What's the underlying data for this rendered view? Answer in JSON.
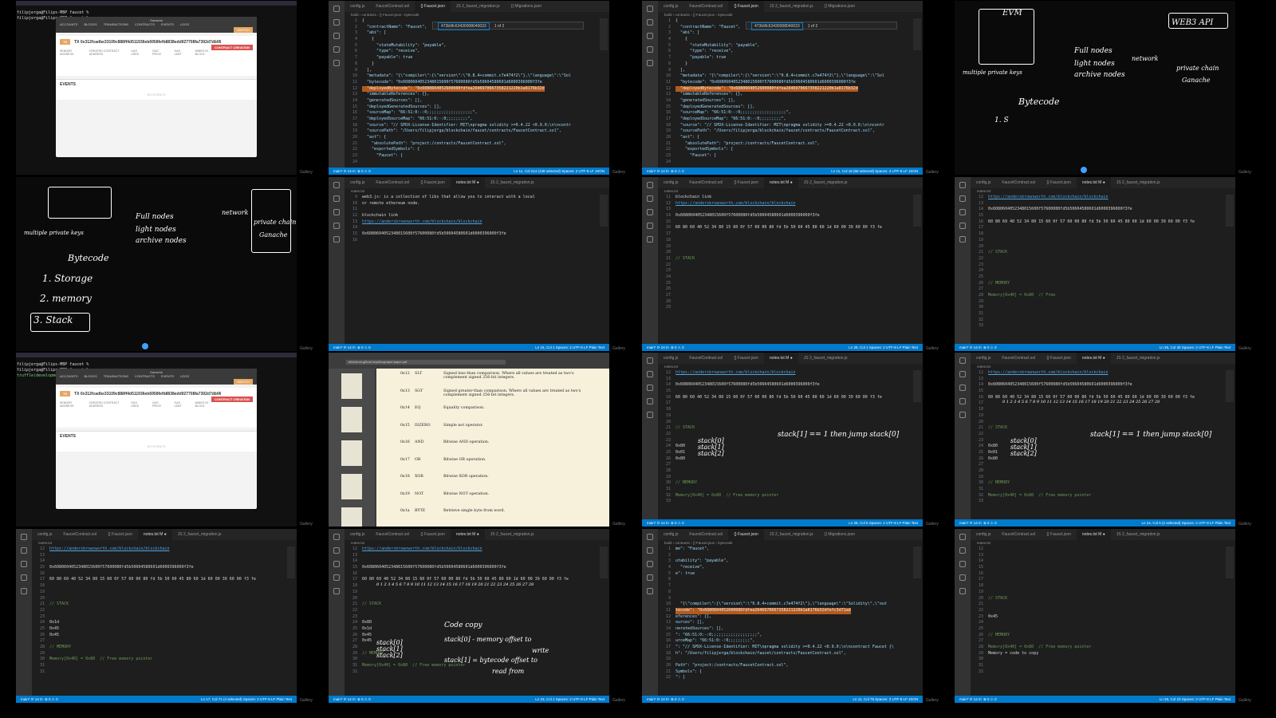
{
  "side_label": "Gallery",
  "editor_tabs_a": [
    "config.js",
    "FaucetContract.sol",
    "{} Faucet.json",
    "JS 2_faucet_migration.js",
    "{} Migrations.json"
  ],
  "editor_tabs_b": [
    "config.js",
    "FaucetContract.sol",
    "{} Faucet.json",
    "notes.txt M ●",
    "JS 2_faucet_migration.js"
  ],
  "branch": "main*  ⟳ 14 0↑  ⊗ 0 ⚠ 0",
  "find": {
    "query": "473b9fc63430008040033",
    "count": "1 of 2"
  },
  "json_crumb": "build › contracts › {} Faucet.json › bytecode",
  "notes_crumb": "notes.txt",
  "json_lines": [
    [
      "{",
      "w"
    ],
    [
      "  \"contractName\": \"Faucet\",",
      "k"
    ],
    [
      "  \"abi\": [",
      "k"
    ],
    [
      "    {",
      "w"
    ],
    [
      "      \"stateMutability\": \"payable\",",
      "k"
    ],
    [
      "      \"type\": \"receive\",",
      "k"
    ],
    [
      "      \"payable\": true",
      "k"
    ],
    [
      "    }",
      "w"
    ],
    [
      "  ],",
      "w"
    ],
    [
      "  \"metadata\": \"{\\\"compiler\\\":{\\\"version\\\":\\\"0.8.4+commit.c7e474f2\\\"},\\\"language\\\":\\\"Sol",
      "k"
    ],
    [
      "  \"bytecode\": \"0x6080604052348015600f57600080fd5b50604580601d6000396000f3fe",
      "k"
    ],
    [
      "  \"deployedBytecode\": \"0x6080604052600080fdfea2646970667358221220b1a8176b32d",
      "sel"
    ],
    [
      "  \"immutableReferences\": {},",
      "k"
    ],
    [
      "  \"generatedSources\": [],",
      "k"
    ],
    [
      "  \"deployedGeneratedSources\": [],",
      "k"
    ],
    [
      "  \"sourceMap\": \"66:51:0:-:0;;;;;;;;;;;;;;;;;;;\",",
      "k"
    ],
    [
      "  \"deployedSourceMap\": \"66:51:0:-:0;;;;;;;;;\",",
      "k"
    ],
    [
      "  \"source\": \"// SPDX-License-Identifier: MIT\\npragma solidity >=0.4.22 <0.9.0;\\n\\ncontr",
      "k"
    ],
    [
      "  \"sourcePath\": \"/Users/filipjerga/blockchain/faucet/contracts/FaucetContract.sol\",",
      "k"
    ],
    [
      "  \"ast\": {",
      "k"
    ],
    [
      "    \"absolutePath\": \"project:/contracts/FaucetContract.sol\",",
      "k"
    ],
    [
      "    \"exportedSymbols\": {",
      "k"
    ],
    [
      "      \"Faucet\": [",
      "k"
    ],
    [
      "        ",
      "w"
    ]
  ],
  "json_lines_scrolled": [
    [
      "me\": \"Faucet\",",
      "k"
    ],
    [
      "",
      "w"
    ],
    [
      "utability\": \"payable\",",
      "k"
    ],
    [
      "  \"receive\",",
      "k"
    ],
    [
      "e\": true",
      "k"
    ],
    [
      "",
      "w"
    ],
    [
      "",
      "w"
    ],
    [
      "",
      "w"
    ],
    [
      "",
      "w"
    ],
    [
      "  \"{\\\"compiler\\\":{\\\"version\\\":\\\"0.8.4+commit.c7e474f2\\\"},\\\"language\\\":\\\"Solidity\\\",\\\"out",
      "k"
    ],
    [
      "tecode\": \"0x6080604052600080fdfea2646970667358221220b1a8176b32dfefc3d71ad",
      "sel"
    ],
    [
      "eferences\": {},",
      "k"
    ],
    [
      "ources\": [],",
      "k"
    ],
    [
      "neratedSources\": [],",
      "k"
    ],
    [
      "\": \"66:51:0:-:0;;;;;;;;;;;;;;;;;;;\",",
      "k"
    ],
    [
      "urceMap\": \"66:51:0:-:0;;;;;;;;;\",",
      "k"
    ],
    [
      "\": \"// SPDX-License-Identifier: MIT\\npragma solidity >=0.4.22 <0.9.0;\\n\\ncontract Faucet {\\",
      "k"
    ],
    [
      "h\": \"/Users/filipjerga/blockchain/faucet/contracts/FaucetContract.sol\",",
      "k"
    ],
    [
      "",
      "w"
    ],
    [
      "Path\": \"project:/contracts/FaucetContract.sol\",",
      "k"
    ],
    [
      "Symbols\": {",
      "k"
    ],
    [
      "\": [",
      "k"
    ]
  ],
  "notes": {
    "intro1": "web3.js: is a collection of libs that allow you to interact with a local",
    "intro2": "or remote ethereum node.",
    "link_label": "blockchain link",
    "url": "https://andersbrownworth.com/blockchain/blockchain",
    "bytecode": "0x6080604052348015600f57600080fd5b50604580601d6000396000f3fe",
    "bytes": "60 80 60 40 52 34 80 15 60 0f 57 60 00 80 fd 5b 50 60 45 80 60 1d 60 00 39 60 00 f3 fe",
    "stack": "// STACK",
    "memory": "// MEMORY",
    "mem_short": "Memory[0x40] = 0x80  // Free",
    "mem_full": "Memory[0x40] = 0x80  // Free memory pointer",
    "mem_copy": "Memory = code to copy",
    "s80": "0x80",
    "s01": "0x01",
    "s1d": "0x1d",
    "s45": "0x45"
  },
  "hand": {
    "indices": "0 1 2 3 4 5 6 7 8 9 10 11 12 13 14 15 16 17 18 19 20 21 22 23 24 25 26 27 28",
    "jump": "stack[1] == 1 then jump stack[0]",
    "st0": "stack[0]",
    "st1": "stack[1]",
    "st2": "stack[2]",
    "codecopy": "Code copy",
    "cc1": "stack[0] - memory offset to",
    "cc2": "write",
    "cc3": "stack[1] = bytecode offset to",
    "cc4": "read from",
    "evm": "EVM",
    "web3": "WEB3 API",
    "full": "Full nodes",
    "light": "light nodes",
    "archive": "archive nodes",
    "network": "network",
    "private": "private chain",
    "ganache": "Ganache",
    "bytecode": "Bytecode",
    "multi": "multiple private keys",
    "one_s": "1. S",
    "storage": "1. Storage",
    "memory": "2. memory",
    "stackn": "3. Stack"
  },
  "ganache": {
    "menu": "Ganache",
    "tabs": [
      "ACCOUNTS",
      "BLOCKS",
      "TRANSACTIONS",
      "CONTRACTS",
      "EVENTS",
      "LOGS"
    ],
    "switch": "SWITCH",
    "tx_label": "TX",
    "tx": "TX 0x312fcadbe33109c888ff4d511936eb6958fefb8838edd927708fa7302d7db06",
    "tx_type": "CONTRACT CREATION",
    "meta": [
      "SENDER ADDRESS",
      "CREATED CONTRACT ADDRESS",
      "GAS USED",
      "GAS PRICE",
      "GAS LIMIT",
      "MINED IN BLOCK"
    ],
    "events": "EVENTS",
    "no_events": "NO EVENTS"
  },
  "terminal": {
    "prompt": "filipjerga@Filips-MBP faucet %",
    "truffle": "truffle(development)>"
  },
  "pdf": {
    "url": "ethereum.github.io/yellowpaper/paper.pdf",
    "ops": [
      [
        "0x12",
        "SLT",
        "Signed less-than comparison. Where all values are treated as two's complement signed 256-bit integers."
      ],
      [
        "0x13",
        "SGT",
        "Signed greater-than comparison. Where all values are treated as two's complement signed 256-bit integers."
      ],
      [
        "0x14",
        "EQ",
        "Equality comparison."
      ],
      [
        "0x15",
        "ISZERO",
        "Simple not operator."
      ],
      [
        "0x16",
        "AND",
        "Bitwise AND operation."
      ],
      [
        "0x17",
        "OR",
        "Bitwise OR operation."
      ],
      [
        "0x18",
        "XOR",
        "Bitwise XOR operation."
      ],
      [
        "0x19",
        "NOT",
        "Bitwise NOT operation."
      ],
      [
        "0x1a",
        "BYTE",
        "Retrieve single byte from word."
      ]
    ]
  },
  "status": {
    "t2": "Ln 11, Col 214 (138 selected)   Spaces: 2   UTF-8   LF   JSON",
    "t3": "Ln 11, Col 18 (58 selected)   Spaces: 2   UTF-8   LF   JSON",
    "t6": "Ln 16, Col 1   Spaces: 2   UTF-8   LF   Plain Text",
    "t7": "Ln 28, Col 1   Spaces: 2   UTF-8   LF   Plain Text",
    "t8": "Ln 28, Col 30   Spaces: 2   UTF-8   LF   Plain Text",
    "t11": "Ln 28, Col 5   Spaces: 2   UTF-8   LF   Plain Text",
    "t12": "Ln 24, Col 5 (2 selected)   Spaces: 2   UTF-8   LF   Plain Text",
    "t13": "Ln 17, Col 71 (4 selected)   Spaces: 2   UTF-8   LF   Plain Text",
    "t14": "Ln 23, Col 1   Spaces: 2   UTF-8   LF   Plain Text",
    "t15": "Ln 11, Col 78   Spaces: 2   UTF-8   LF   JSON",
    "t16": "Ln 28, Col 23   Spaces: 2   UTF-8   LF   Plain Text"
  }
}
